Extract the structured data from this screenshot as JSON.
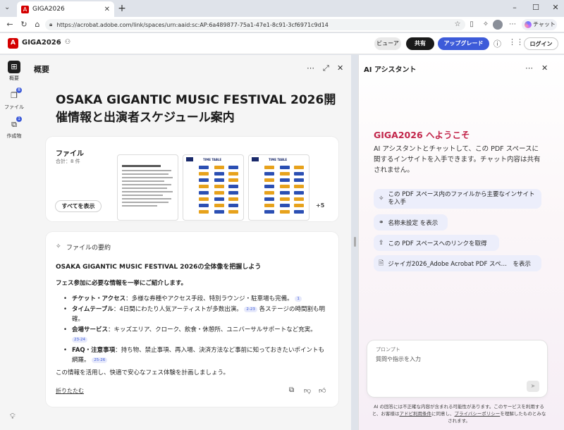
{
  "browser": {
    "tab_title": "GIGA2026",
    "url": "https://acrobat.adobe.com/link/spaces/urn:aaid:sc:AP:6a489877-75a1-47e1-8c91-3cf6971c9d14",
    "chat_chip": "チャット"
  },
  "app": {
    "name": "GIGA2026",
    "view_label": "ビューア",
    "share_label": "共有",
    "upgrade_label": "アップグレード",
    "login_label": "ログイン"
  },
  "rail": {
    "items": [
      {
        "label": "概要",
        "badge": ""
      },
      {
        "label": "ファイル",
        "badge": "8"
      },
      {
        "label": "作成物",
        "badge": "1"
      }
    ]
  },
  "main": {
    "pane_title": "概要",
    "doc_title": "OSAKA GIGANTIC MUSIC FESTIVAL 2026開催情報と出演者スケジュール案内",
    "files": {
      "label": "ファイル",
      "count": "合計：8 件",
      "show_all": "すべてを表示",
      "more": "+5",
      "thumb_heading": "TIME TABLE"
    },
    "summary": {
      "label": "ファイルの要約",
      "heading": "OSAKA GIGANTIC MUSIC FESTIVAL 2026の全体像を把握しよう",
      "subheading": "フェス参加に必要な情報を一挙にご紹介します。",
      "bullets": [
        {
          "term": "チケット・アクセス",
          "text": "：多様な券種やアクセス手段、特別ラウンジ・駐車場も完備。",
          "ref": "1"
        },
        {
          "term": "タイムテーブル",
          "text": "：4日間にわたり人気アーティストが多数出演。",
          "ref": "2-23",
          "text2": "各ステージの時間割も明確。"
        },
        {
          "term": "会場サービス",
          "text": "：キッズエリア、クローク、飲食・休憩所、ユニバーサルサポートなど充実。",
          "ref": "23-24"
        },
        {
          "term": "FAQ・注意事項",
          "text": "：持ち物、禁止事項、再入場、決済方法など事前に知っておきたいポイントも網羅。",
          "ref": "25-26"
        }
      ],
      "closing": "この情報を活用し、快適で安心なフェス体験を計画しましょう。",
      "collapse": "折りたたむ"
    }
  },
  "ai": {
    "title": "AI アシスタント",
    "welcome": "GIGA2026 へようこそ",
    "description": "AI アシスタントとチャットして、この PDF スペースに関するインサイトを入手できます。チャット内容は共有されません。",
    "suggestions": [
      "この PDF スペース内のファイルから主要なインサイトを入手",
      "名称未設定 を表示",
      "この PDF スペースへのリンクを取得",
      "ジャイガ2026_Adobe Acrobat PDF スペ…　を表示"
    ],
    "prompt_label": "プロンプト",
    "prompt_placeholder": "質問や指示を入力",
    "disclaimer_pre": "AI の回答には不正確な内容が含まれる可能性があります。このサービスを利用すると、お客様は",
    "disclaimer_link1": "アドビ利用条件",
    "disclaimer_mid": "に同意し、",
    "disclaimer_link2": "プライバシーポリシー",
    "disclaimer_post": "を理解したものとみなされます。"
  },
  "colors": {
    "accent_blue": "#3d5bd9",
    "brand_red": "#d40000",
    "welcome_red": "#c2264b"
  }
}
